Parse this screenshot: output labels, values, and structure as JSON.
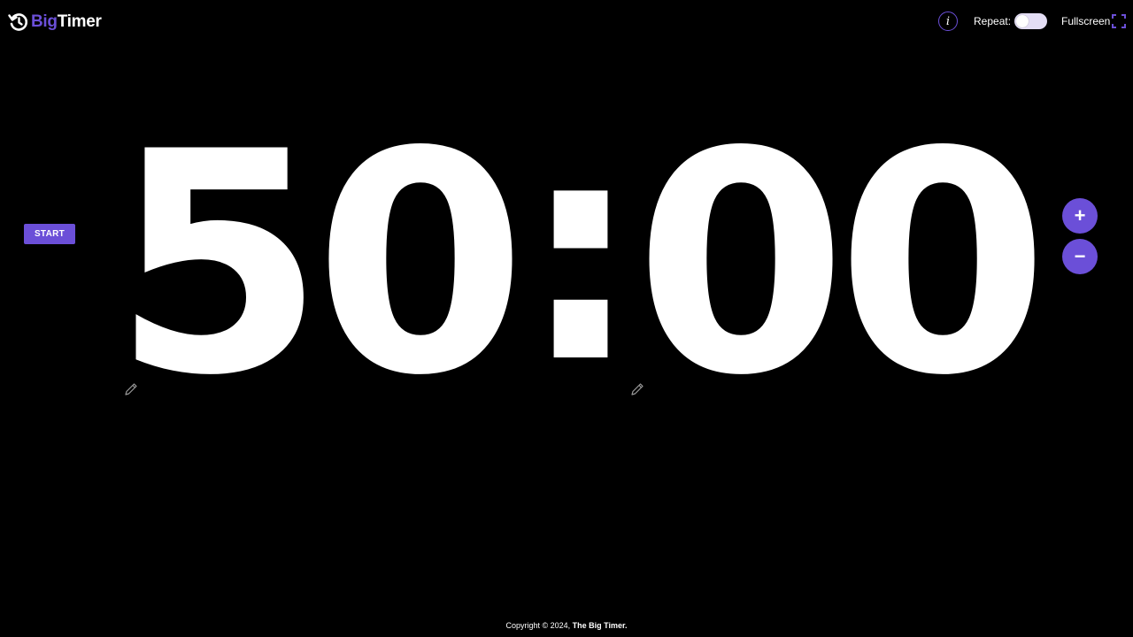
{
  "logo": {
    "part1": "Big",
    "part2": "Timer",
    "icon": "clock-history-icon",
    "accent_color": "#6b4fd8"
  },
  "header": {
    "info_symbol": "i",
    "repeat_label": "Repeat:",
    "repeat_enabled": false,
    "fullscreen_label": "Fullscreen"
  },
  "controls": {
    "start_label": "START",
    "plus_symbol": "+",
    "minus_symbol": "−"
  },
  "timer": {
    "minutes": "50",
    "separator": ":",
    "seconds": "00"
  },
  "footer": {
    "text": "Copyright © 2024, ",
    "brand": "The Big Timer."
  },
  "colors": {
    "background": "#000000",
    "accent": "#6b4fd8",
    "toggle_track": "#e4def5",
    "text": "#ffffff"
  }
}
